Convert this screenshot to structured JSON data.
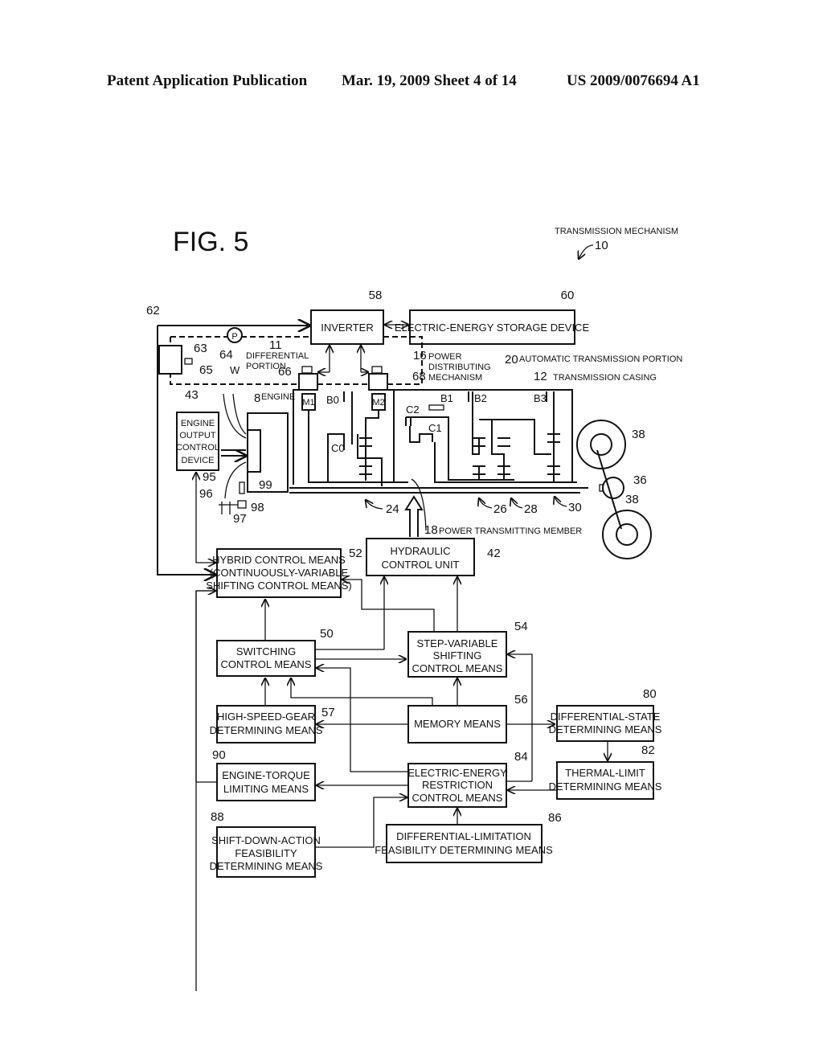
{
  "header": {
    "publication": "Patent Application Publication",
    "date_sheet": "Mar. 19, 2009  Sheet 4 of 14",
    "number": "US 2009/0076694 A1"
  },
  "figure": {
    "title": "FIG. 5",
    "mechanism_label": "TRANSMISSION MECHANISM",
    "mechanism_ref": "10"
  },
  "blocks": {
    "inverter": {
      "label": "INVERTER",
      "ref": "58"
    },
    "storage": {
      "label": "ELECTRIC-ENERGY STORAGE DEVICE",
      "ref": "60"
    },
    "engine_output": {
      "lines": [
        "ENGINE",
        "OUTPUT",
        "CONTROL",
        "DEVICE"
      ],
      "ref": "43"
    },
    "engine": {
      "label": "ENGINE",
      "ref": "8"
    },
    "hybrid": {
      "lines": [
        "HYBRID CONTROL MEANS",
        "(CONTINUOUSLY-VARIABLE",
        "SHIFTING CONTROL MEANS)"
      ],
      "ref": "52"
    },
    "hydraulic": {
      "lines": [
        "HYDRAULIC",
        "CONTROL UNIT"
      ],
      "ref": "42"
    },
    "switching": {
      "lines": [
        "SWITCHING",
        "CONTROL MEANS"
      ],
      "ref": "50"
    },
    "step_variable": {
      "lines": [
        "STEP-VARIABLE",
        "SHIFTING",
        "CONTROL MEANS"
      ],
      "ref": "54"
    },
    "high_speed": {
      "lines": [
        "HIGH-SPEED-GEAR",
        "DETERMINING MEANS"
      ],
      "ref": "57"
    },
    "memory": {
      "label": "MEMORY MEANS",
      "ref": "56"
    },
    "diff_state": {
      "lines": [
        "DIFFERENTIAL-STATE",
        "DETERMINING MEANS"
      ],
      "ref": "80"
    },
    "engine_torque": {
      "lines": [
        "ENGINE-TORQUE",
        "LIMITING MEANS"
      ],
      "ref": "90"
    },
    "ee_restriction": {
      "lines": [
        "ELECTRIC-ENERGY",
        "RESTRICTION",
        "CONTROL MEANS"
      ],
      "ref": "84"
    },
    "thermal_limit": {
      "lines": [
        "THERMAL-LIMIT",
        "DETERMINING MEANS"
      ],
      "ref": "82"
    },
    "shift_down": {
      "lines": [
        "SHIFT-DOWN-ACTION",
        "FEASIBILITY",
        "DETERMINING MEANS"
      ],
      "ref": "88"
    },
    "diff_limitation": {
      "lines": [
        "DIFFERENTIAL-LIMITATION",
        "FEASIBILITY DETERMINING MEANS"
      ],
      "ref": "86"
    }
  },
  "labels": {
    "differential_portion": [
      "DIFFERENTIAL",
      "PORTION"
    ],
    "differential_ref": "11",
    "power_distributing": [
      "POWER",
      "DISTRIBUTING",
      "MECHANISM"
    ],
    "power_distributing_ref": "16",
    "automatic_transmission": "AUTOMATIC TRANSMISSION PORTION",
    "automatic_transmission_ref": "20",
    "transmission_casing": "TRANSMISSION CASING",
    "transmission_casing_ref": "12",
    "power_transmitting": "POWER TRANSMITTING MEMBER",
    "power_transmitting_ref": "18",
    "motor1": "M1",
    "motor2": "M2",
    "brakes": [
      "B0",
      "B1",
      "B2",
      "B3"
    ],
    "clutches": [
      "C0",
      "C1",
      "C2"
    ],
    "pump": "P",
    "wire": "W",
    "refs": {
      "r62": "62",
      "r63": "63",
      "r64": "64",
      "r65": "65",
      "r66": "66",
      "r68": "68",
      "r24": "24",
      "r26": "26",
      "r28": "28",
      "r30": "30",
      "r36": "36",
      "r38a": "38",
      "r38b": "38",
      "r95": "95",
      "r96": "96",
      "r97": "97",
      "r98": "98",
      "r99": "99"
    }
  }
}
